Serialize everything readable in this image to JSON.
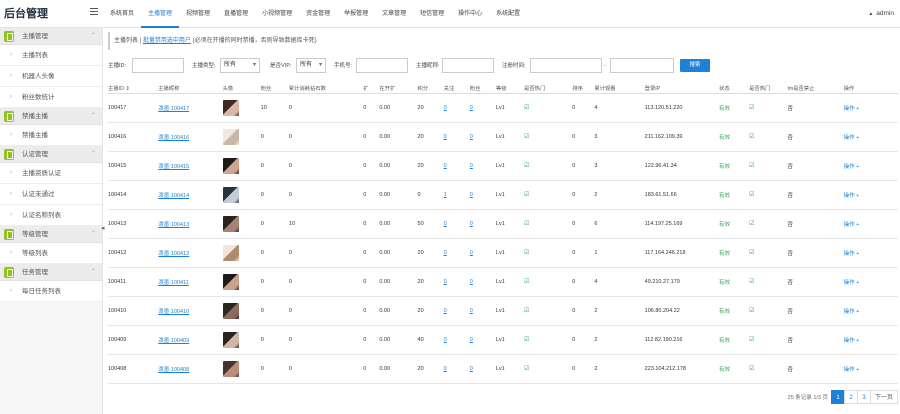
{
  "app": {
    "title": "后台管理"
  },
  "topnav": [
    "系统首页",
    "主播管理",
    "视频管理",
    "直播管理",
    "小视频管理",
    "资金管理",
    "举报管理",
    "文章管理",
    "短信管理",
    "操作中心",
    "系统配置"
  ],
  "active_tab_index": 1,
  "user": {
    "name": "admin"
  },
  "sidebar": [
    {
      "group": "主播管理",
      "items": [
        "主播列表",
        "机器人头像",
        "粉丝数统计"
      ]
    },
    {
      "group": "禁播主播",
      "items": [
        "禁播主播"
      ]
    },
    {
      "group": "认证管理",
      "items": [
        "主播资质认证",
        "认证未通过",
        "认证名称列表"
      ]
    },
    {
      "group": "等级管理",
      "items": [
        "等级列表"
      ]
    },
    {
      "group": "任务管理",
      "items": [
        "每日任务列表"
      ]
    }
  ],
  "breadcrumb": {
    "prefix": "主播列表",
    "link": "批量禁用选中用户",
    "note": "(必须在开播的同时禁播，否则导致数据库卡死)"
  },
  "filters": {
    "anchor_id_label": "主播ID:",
    "anchor_type_label": "主播类型:",
    "anchor_type_value": "所有",
    "vip_label": "是否VIP:",
    "vip_value": "所有",
    "phone_label": "手机号:",
    "bind_label": "主播昵称:",
    "reg_time_label": "注册时间:",
    "range_sep": "-",
    "search_button": "搜索"
  },
  "table": {
    "columns": [
      "主播ID ⇕",
      "主播昵称",
      "头像",
      "粉丝",
      "累计消耗钻石数",
      "扩",
      "在开扩",
      "积分",
      "关注",
      "粉丝",
      "等级",
      "是否热门",
      "排序",
      "累计观看",
      "登录IP",
      "状态",
      "是否热门",
      "Im是否禁止",
      "操作"
    ],
    "rows": [
      {
        "id": "100417",
        "nick": "泼墨:100417",
        "fans": "10",
        "cost": "0",
        "a": "0",
        "b": "0.00",
        "score": "20",
        "follow": "0",
        "fan2": "0",
        "level": "Lv1",
        "sort": "0",
        "views": "4",
        "ip": "113.120.51.220",
        "status": "有效",
        "im": "否",
        "op": "操作 +"
      },
      {
        "id": "100416",
        "nick": "泼墨:100416",
        "fans": "0",
        "cost": "0",
        "a": "0",
        "b": "0.00",
        "score": "20",
        "follow": "0",
        "fan2": "0",
        "level": "Lv1",
        "sort": "0",
        "views": "3",
        "ip": "211.162.109.39",
        "status": "有效",
        "im": "否",
        "op": "操作 +"
      },
      {
        "id": "100415",
        "nick": "泼墨:100415",
        "fans": "0",
        "cost": "0",
        "a": "0",
        "b": "0.00",
        "score": "20",
        "follow": "0",
        "fan2": "0",
        "level": "Lv1",
        "sort": "0",
        "views": "3",
        "ip": "122.96.41.34",
        "status": "有效",
        "im": "否",
        "op": "操作 +"
      },
      {
        "id": "100414",
        "nick": "泼墨:100414",
        "fans": "0",
        "cost": "0",
        "a": "0",
        "b": "0.00",
        "score": "0",
        "follow": "1",
        "fan2": "0",
        "level": "Lv1",
        "sort": "0",
        "views": "2",
        "ip": "183.61.51.66",
        "status": "有效",
        "im": "否",
        "op": "操作 +"
      },
      {
        "id": "100413",
        "nick": "泼墨:100413",
        "fans": "0",
        "cost": "10",
        "a": "0",
        "b": "0.00",
        "score": "50",
        "follow": "0",
        "fan2": "0",
        "level": "Lv1",
        "sort": "0",
        "views": "6",
        "ip": "114.197.25.169",
        "status": "有效",
        "im": "否",
        "op": "操作 +"
      },
      {
        "id": "100412",
        "nick": "泼墨:100412",
        "fans": "0",
        "cost": "0",
        "a": "0",
        "b": "0.00",
        "score": "20",
        "follow": "0",
        "fan2": "0",
        "level": "Lv1",
        "sort": "0",
        "views": "1",
        "ip": "117.164.246.218",
        "status": "有效",
        "im": "否",
        "op": "操作 +"
      },
      {
        "id": "100411",
        "nick": "泼墨:100411",
        "fans": "0",
        "cost": "0",
        "a": "0",
        "b": "0.00",
        "score": "20",
        "follow": "0",
        "fan2": "0",
        "level": "Lv1",
        "sort": "0",
        "views": "4",
        "ip": "49.210.27.179",
        "status": "有效",
        "im": "否",
        "op": "操作 +"
      },
      {
        "id": "100410",
        "nick": "泼墨:100410",
        "fans": "0",
        "cost": "0",
        "a": "0",
        "b": "0.00",
        "score": "20",
        "follow": "0",
        "fan2": "0",
        "level": "Lv1",
        "sort": "0",
        "views": "2",
        "ip": "106.80.204.22",
        "status": "有效",
        "im": "否",
        "op": "操作 +"
      },
      {
        "id": "100409",
        "nick": "泼墨:100409",
        "fans": "0",
        "cost": "0",
        "a": "0",
        "b": "0.00",
        "score": "40",
        "follow": "0",
        "fan2": "0",
        "level": "Lv1",
        "sort": "0",
        "views": "2",
        "ip": "112.82.190.216",
        "status": "有效",
        "im": "否",
        "op": "操作 +"
      },
      {
        "id": "100408",
        "nick": "泼墨:100408",
        "fans": "0",
        "cost": "0",
        "a": "0",
        "b": "0.00",
        "score": "20",
        "follow": "0",
        "fan2": "0",
        "level": "Lv1",
        "sort": "0",
        "views": "2",
        "ip": "223.104.212.178",
        "status": "有效",
        "im": "否",
        "op": "操作 +"
      }
    ]
  },
  "pager": {
    "info": "25 条记录 1/3 页",
    "pages": [
      "1",
      "2",
      "3"
    ],
    "next": "下一页",
    "active": 0
  },
  "colors": {
    "accent": "#1f80d8",
    "ok": "#3aa85a"
  }
}
